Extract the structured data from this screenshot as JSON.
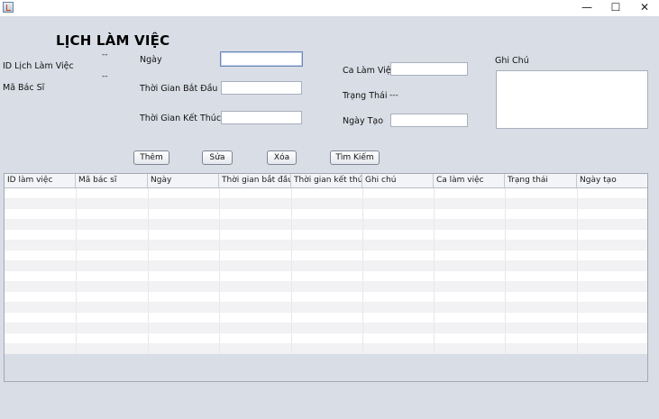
{
  "window": {
    "minimize": "—",
    "maximize": "☐",
    "close": "✕"
  },
  "header": {
    "title": "LỊCH LÀM VIỆC"
  },
  "form": {
    "id_label": "ID  Lịch Làm Việc",
    "id_value": "--",
    "doctor_label": "Mã Bác Sĩ",
    "doctor_value": "--",
    "date_label": "Ngày",
    "start_label": "Thời Gian Bắt Đầu",
    "end_label": "Thời Gian Kết Thúc",
    "shift_label": "Ca Làm Việc",
    "status_label": "Trạng Thái",
    "status_value": "---",
    "created_label": "Ngày Tạo",
    "note_label": "Ghi Chú"
  },
  "toolbar": {
    "add": "Thêm",
    "edit": "Sửa",
    "delete": "Xóa",
    "search": "Tìm Kiếm"
  },
  "table": {
    "columns": [
      "ID làm việc",
      "Mã bác sĩ",
      "Ngày",
      "Thời gian bắt đầu",
      "Thời gian kết thúc",
      "Ghi chú",
      "Ca làm việc",
      "Trạng thái",
      "Ngày tạo"
    ],
    "rows": []
  }
}
